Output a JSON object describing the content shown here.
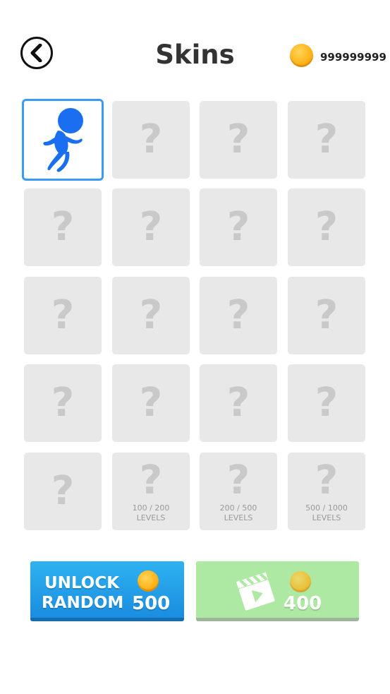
{
  "header": {
    "title": "Skins",
    "coins": "999999999"
  },
  "grid": {
    "locked_symbol": "?",
    "tiles": [
      {
        "state": "selected",
        "label": ""
      },
      {
        "state": "locked",
        "label": ""
      },
      {
        "state": "locked",
        "label": ""
      },
      {
        "state": "locked",
        "label": ""
      },
      {
        "state": "locked",
        "label": ""
      },
      {
        "state": "locked",
        "label": ""
      },
      {
        "state": "locked",
        "label": ""
      },
      {
        "state": "locked",
        "label": ""
      },
      {
        "state": "locked",
        "label": ""
      },
      {
        "state": "locked",
        "label": ""
      },
      {
        "state": "locked",
        "label": ""
      },
      {
        "state": "locked",
        "label": ""
      },
      {
        "state": "locked",
        "label": ""
      },
      {
        "state": "locked",
        "label": ""
      },
      {
        "state": "locked",
        "label": ""
      },
      {
        "state": "locked",
        "label": ""
      },
      {
        "state": "locked",
        "label": ""
      },
      {
        "state": "locked",
        "label": "100 / 200\nLEVELS"
      },
      {
        "state": "locked",
        "label": "200 / 500\nLEVELS"
      },
      {
        "state": "locked",
        "label": "500 / 1000\nLEVELS"
      }
    ]
  },
  "buttons": {
    "unlock_line1": "UNLOCK",
    "unlock_line2": "RANDOM",
    "unlock_price": "500",
    "video_price": "400"
  },
  "colors": {
    "selected_border": "#3a9bf5",
    "runner": "#1a6ff0",
    "unlock_button": "#2aa6ee",
    "video_button": "#aee9a3",
    "coin": "#ffb51c"
  },
  "icons": {
    "back": "chevron-left-icon",
    "coin": "coin-icon",
    "video": "clapperboard-play-icon",
    "skin": "blue-runner-figure"
  }
}
